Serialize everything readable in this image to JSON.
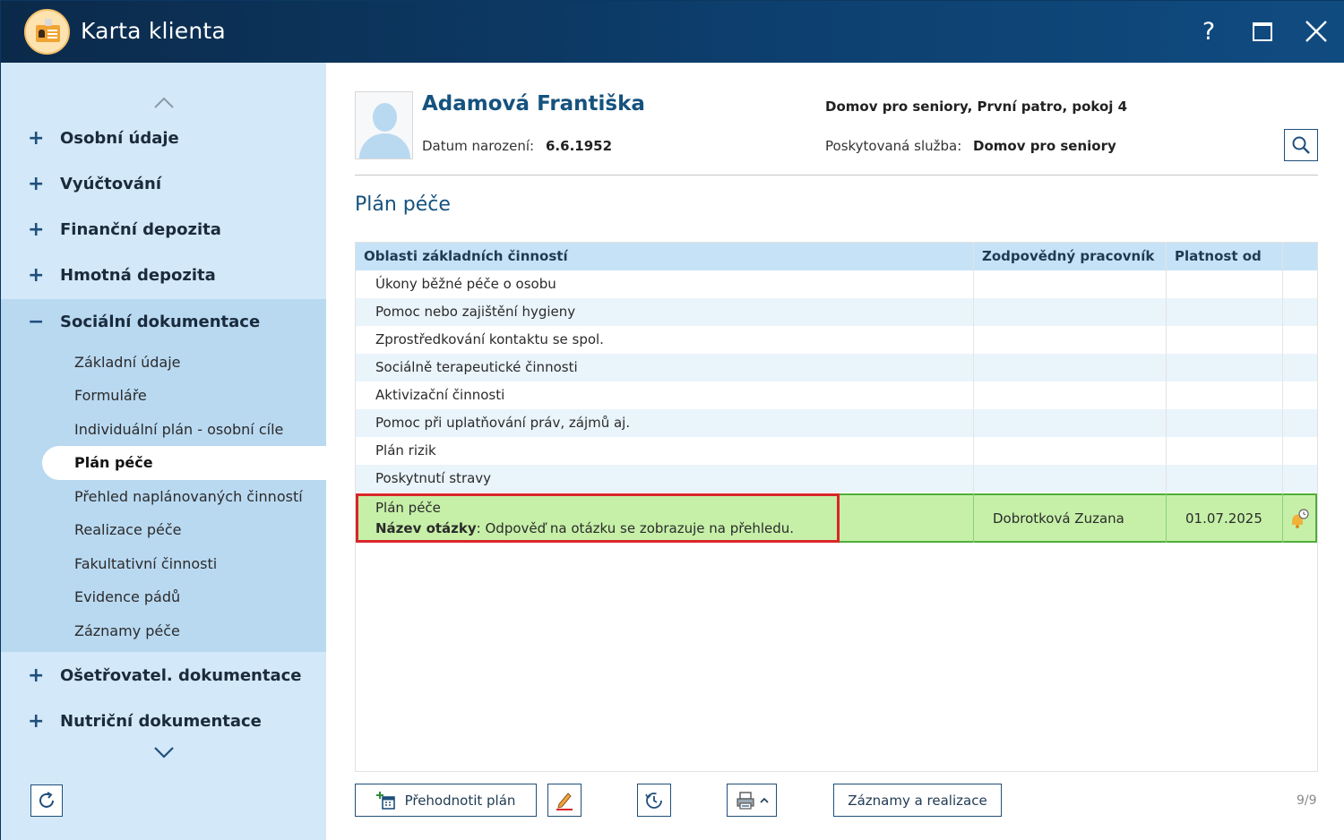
{
  "window": {
    "title": "Karta klienta",
    "help_label": "?"
  },
  "sidebar": {
    "items": [
      {
        "sign": "+",
        "label": "Osobní údaje"
      },
      {
        "sign": "+",
        "label": "Vyúčtování"
      },
      {
        "sign": "+",
        "label": "Finanční depozita"
      },
      {
        "sign": "+",
        "label": "Hmotná depozita"
      },
      {
        "sign": "−",
        "label": "Sociální dokumentace"
      },
      {
        "sign": "+",
        "label": "Ošetřovatel. dokumentace"
      },
      {
        "sign": "+",
        "label": "Nutriční dokumentace"
      }
    ],
    "sub_items": [
      "Základní údaje",
      "Formuláře",
      "Individuální plán - osobní cíle",
      "Plán péče",
      "Přehled naplánovaných činností",
      "Realizace péče",
      "Fakultativní činnosti",
      "Evidence pádů",
      "Záznamy péče"
    ],
    "active_sub_item": "Plán péče"
  },
  "client": {
    "name": "Adamová Františka",
    "birth_label": "Datum narození:",
    "birth_date": "6.6.1952",
    "location": "Domov pro seniory, První patro, pokoj 4",
    "service_label": "Poskytovaná služba:",
    "service": "Domov pro seniory"
  },
  "section": {
    "title": "Plán péče"
  },
  "grid": {
    "columns": [
      "Oblasti základních činností",
      "Zodpovědný pracovník",
      "Platnost od"
    ],
    "rows": [
      "Úkony běžné péče o osobu",
      "Pomoc nebo zajištění hygieny",
      "Zprostředkování kontaktu se spol.",
      "Sociálně terapeutické činnosti",
      "Aktivizační činnosti",
      "Pomoc při uplatňování práv, zájmů aj.",
      "Plán rizik",
      "Poskytnutí stravy"
    ],
    "selected_row": {
      "name": "Plán péče",
      "question_label": "Název otázky",
      "question_text": ": Odpověď na otázku se zobrazuje na přehledu.",
      "worker": "Dobrotková Zuzana",
      "valid_from": "01.07.2025"
    }
  },
  "footer": {
    "renew_plan_label": "Přehodnotit plán",
    "records_label": "Záznamy a realizace",
    "page_counter": "9/9"
  },
  "colors": {
    "titlebar": "#0d4070",
    "sidebar": "#d3e8f8",
    "sidebar_expanded": "#b9d9f1",
    "accent_text": "#15527f",
    "selected_row": "#c6f0a8",
    "highlight_box": "#d9262a"
  },
  "icons": [
    "app-logo-icon",
    "help-icon",
    "maximize-icon",
    "close-icon",
    "chevron-up-icon",
    "chevron-down-icon",
    "refresh-icon",
    "search-icon",
    "bell-icon",
    "calendar-add-icon",
    "pencil-icon",
    "history-icon",
    "printer-icon"
  ]
}
